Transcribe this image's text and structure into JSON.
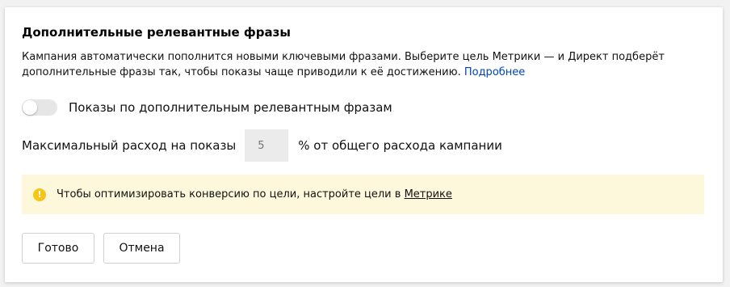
{
  "panel": {
    "title": "Дополнительные релевантные фразы",
    "description_line1": "Кампания автоматически пополнится новыми ключевыми фразами. Выберите цель Метрики — и Директ подберёт",
    "description_line2": "дополнительные фразы так, чтобы показы чаще приводили к её достижению. ",
    "more_link": "Подробнее"
  },
  "toggle": {
    "label": "Показы по дополнительным релевантным фразам",
    "checked": false
  },
  "spend": {
    "label": "Максимальный расход на показы",
    "placeholder": "5",
    "value": "",
    "suffix": "% от общего расхода кампании"
  },
  "notice": {
    "icon": "warning-icon",
    "text": "Чтобы оптимизировать конверсию по цели, настройте цели в ",
    "link": "Метрике",
    "color": "#fdf8dc"
  },
  "buttons": {
    "done": "Готово",
    "cancel": "Отмена"
  },
  "colors": {
    "link": "#0044bb",
    "warning": "#f5c518"
  }
}
